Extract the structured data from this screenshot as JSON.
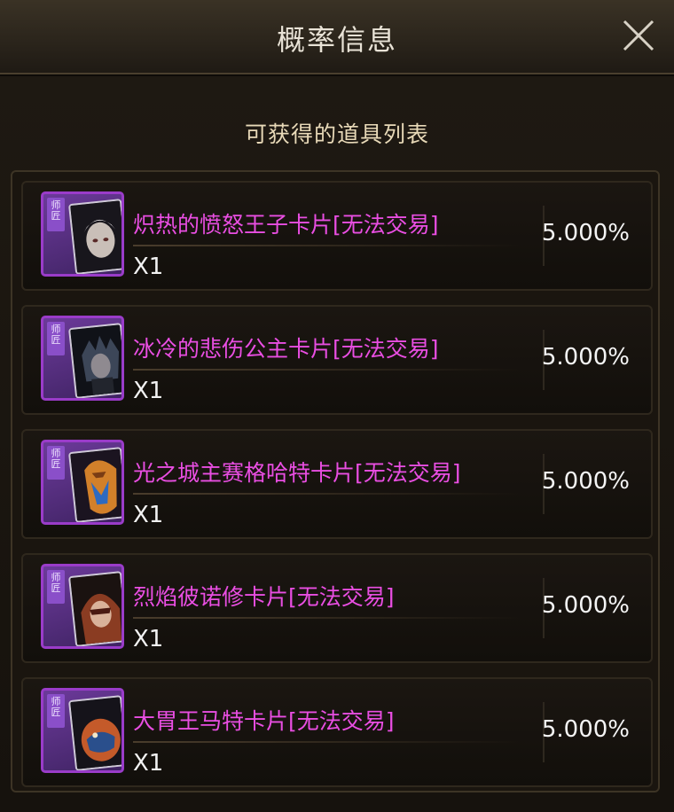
{
  "window": {
    "title": "概率信息",
    "subtitle": "可获得的道具列表"
  },
  "items": [
    {
      "tag": "师匠",
      "name": "炽热的愤怒王子卡片[无法交易]",
      "qty": "X1",
      "prob": "5.000%",
      "art_color": "#b9b2b6",
      "art": "hero-pale-hair"
    },
    {
      "tag": "师匠",
      "name": "冰冷的悲伤公主卡片[无法交易]",
      "qty": "X1",
      "prob": "5.000%",
      "art_color": "#3c4658",
      "art": "hero-dark-armor"
    },
    {
      "tag": "师匠",
      "name": "光之城主赛格哈特卡片[无法交易]",
      "qty": "X1",
      "prob": "5.000%",
      "art_color": "#d2802a",
      "art": "hero-gold-mask"
    },
    {
      "tag": "师匠",
      "name": "烈焰彼诺修卡片[无法交易]",
      "qty": "X1",
      "prob": "5.000%",
      "art_color": "#8a3c22",
      "art": "hero-red-hood"
    },
    {
      "tag": "师匠",
      "name": "大胃王马特卡片[无法交易]",
      "qty": "X1",
      "prob": "5.000%",
      "art_color": "#c45a2a",
      "art": "hero-orange-beast"
    }
  ]
}
